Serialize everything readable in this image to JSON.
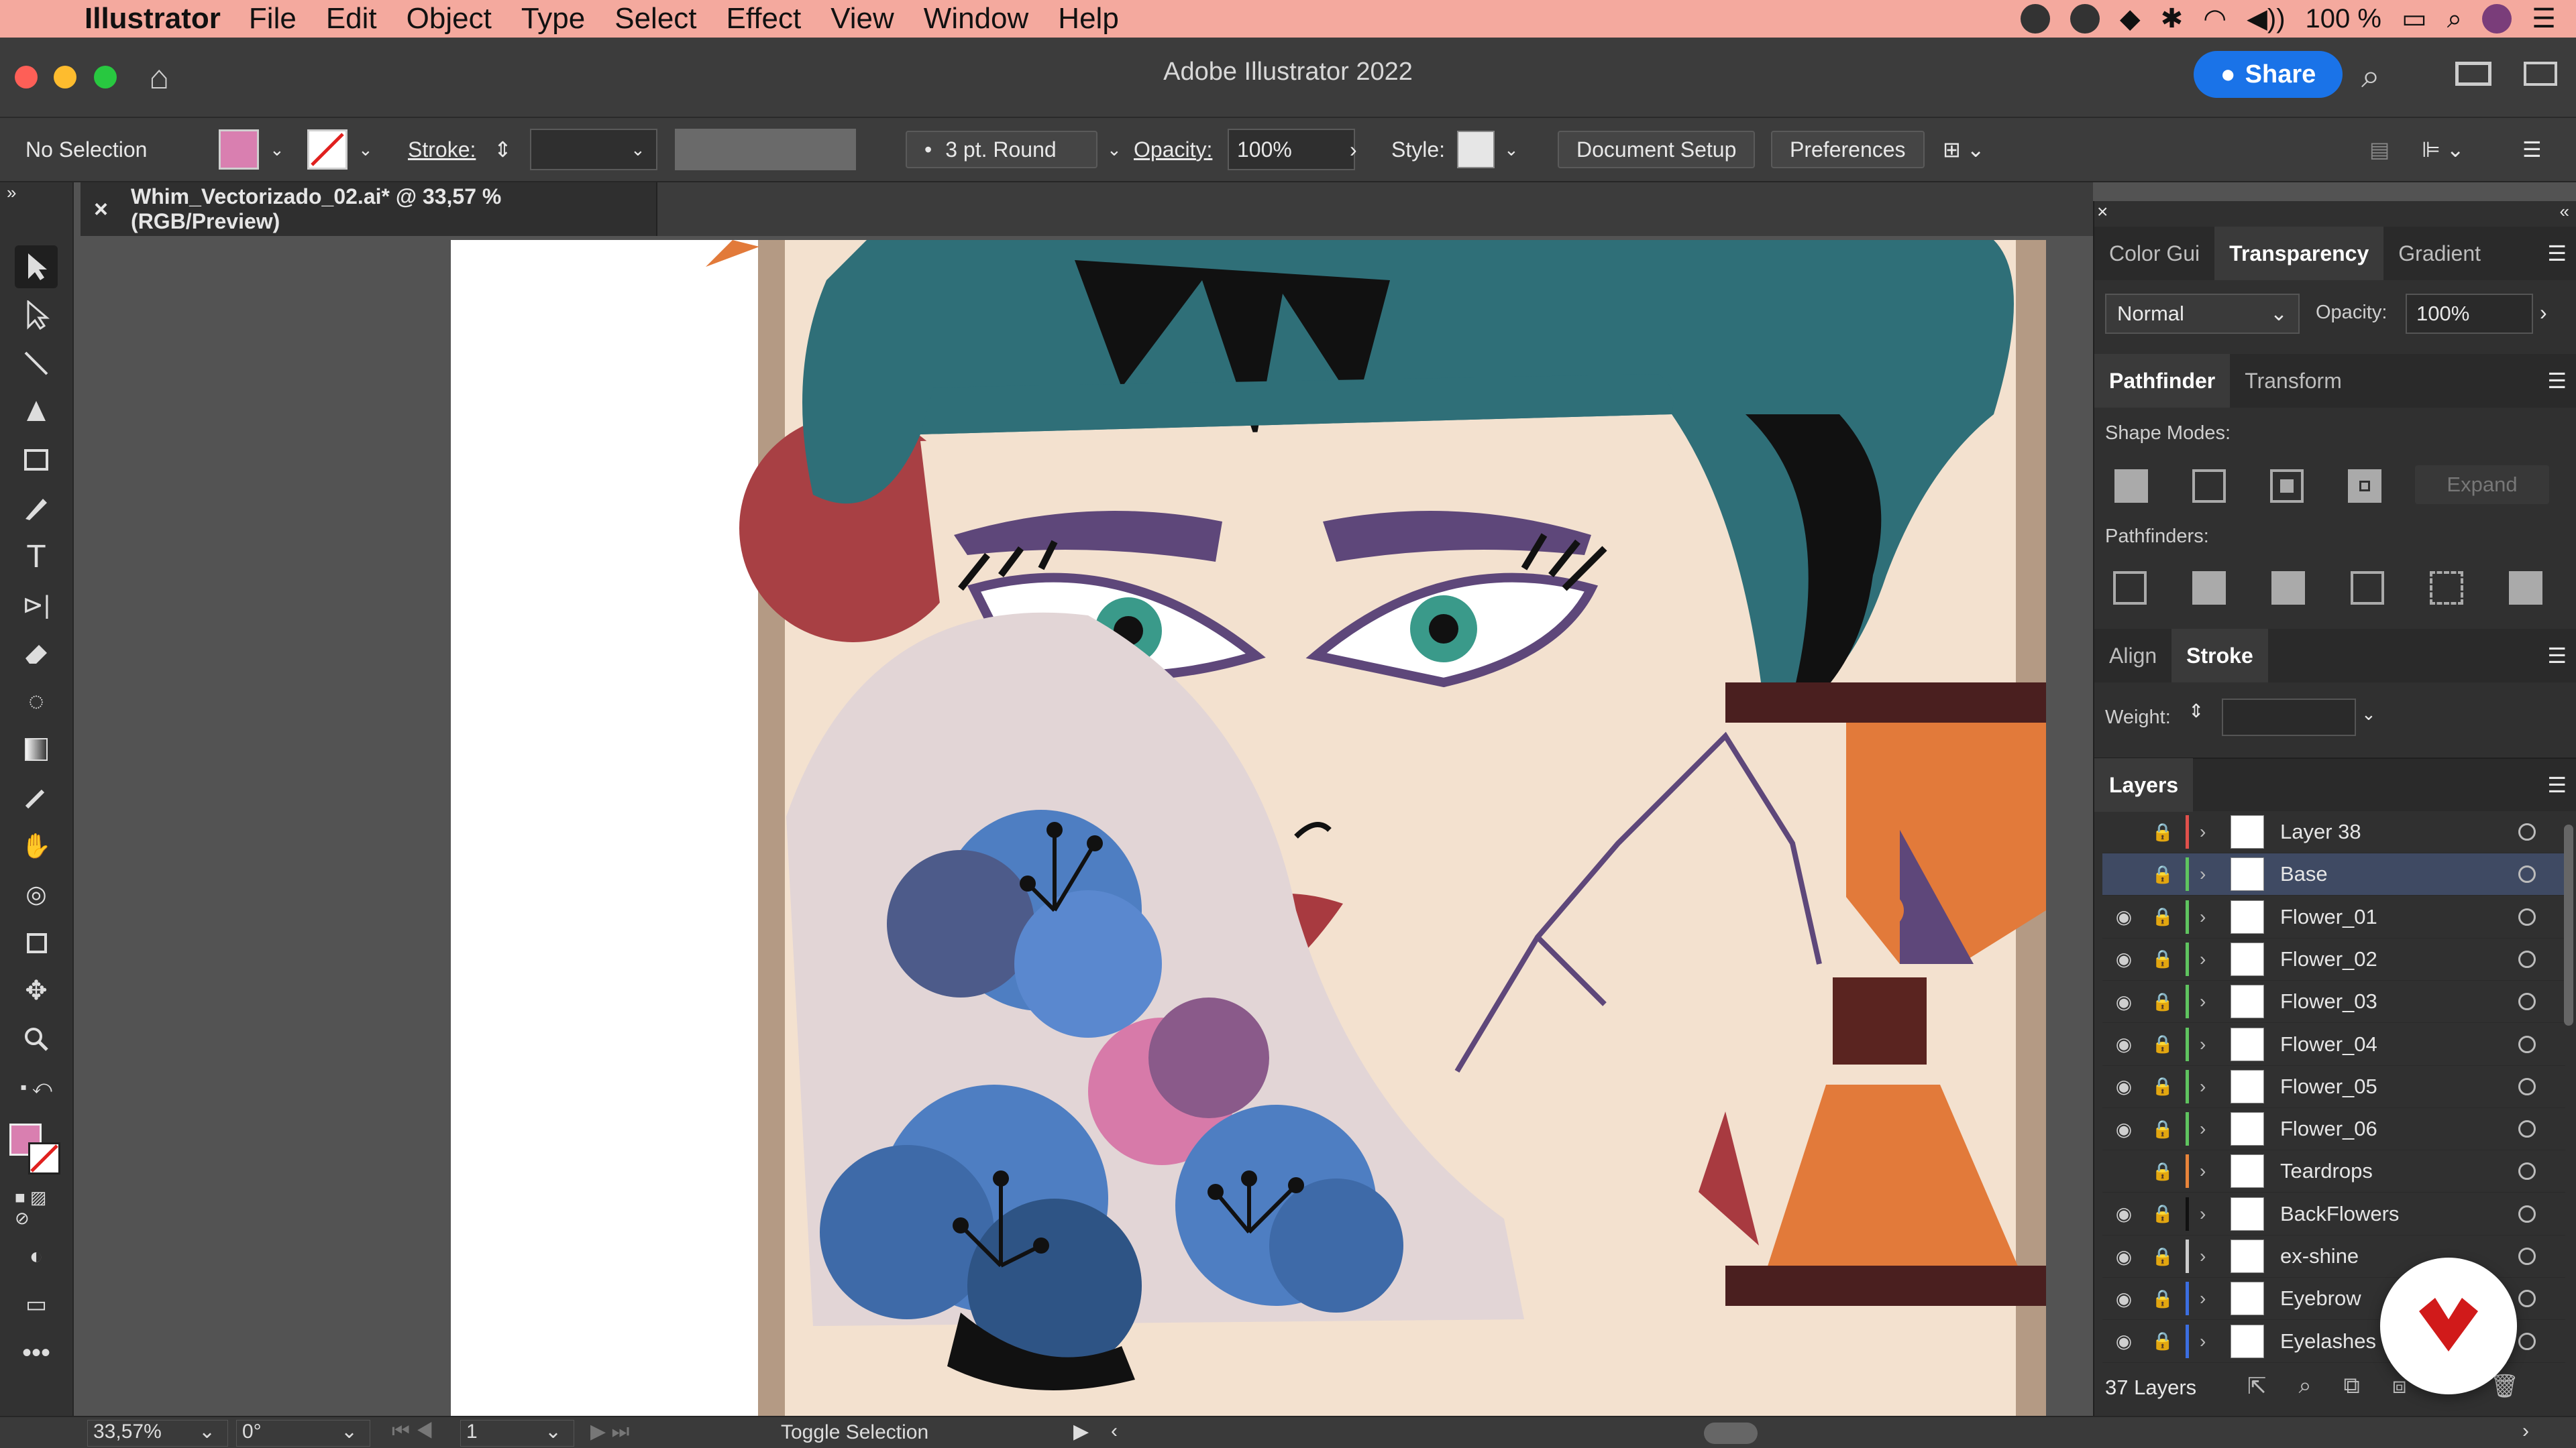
{
  "menubar": {
    "app": "Illustrator",
    "items": [
      "File",
      "Edit",
      "Object",
      "Type",
      "Select",
      "Effect",
      "View",
      "Window",
      "Help"
    ],
    "battery": "100 %"
  },
  "window": {
    "title": "Adobe Illustrator 2022",
    "share": "Share"
  },
  "control": {
    "selection": "No Selection",
    "stroke_label": "Stroke:",
    "brush": "3 pt. Round",
    "opacity_label": "Opacity:",
    "opacity": "100%",
    "style_label": "Style:",
    "document_setup": "Document Setup",
    "preferences": "Preferences",
    "fill_color": "#d97fb0"
  },
  "doc_tab": {
    "name": "Whim_Vectorizado_02.ai* @ 33,57 % (RGB/Preview)"
  },
  "panels": {
    "tabs1": [
      "Color Gui",
      "Transparency",
      "Gradient"
    ],
    "blend_mode": "Normal",
    "opacity_label": "Opacity:",
    "opacity": "100%",
    "tabs2": [
      "Pathfinder",
      "Transform"
    ],
    "shape_modes": "Shape Modes:",
    "expand": "Expand",
    "pathfinders": "Pathfinders:",
    "tabs3": [
      "Align",
      "Stroke"
    ],
    "weight_label": "Weight:",
    "layers_title": "Layers",
    "layers_count": "37 Layers",
    "layers": [
      {
        "name": "Layer 38",
        "color": "#e0504b",
        "visible": false,
        "selected": false
      },
      {
        "name": "Base",
        "color": "#5fc45f",
        "visible": false,
        "selected": true
      },
      {
        "name": "Flower_01",
        "color": "#5fc45f",
        "visible": true,
        "selected": false
      },
      {
        "name": "Flower_02",
        "color": "#5fc45f",
        "visible": true,
        "selected": false
      },
      {
        "name": "Flower_03",
        "color": "#5fc45f",
        "visible": true,
        "selected": false
      },
      {
        "name": "Flower_04",
        "color": "#5fc45f",
        "visible": true,
        "selected": false
      },
      {
        "name": "Flower_05",
        "color": "#5fc45f",
        "visible": true,
        "selected": false
      },
      {
        "name": "Flower_06",
        "color": "#5fc45f",
        "visible": true,
        "selected": false
      },
      {
        "name": "Teardrops",
        "color": "#e8843a",
        "visible": false,
        "selected": false
      },
      {
        "name": "BackFlowers",
        "color": "#111111",
        "visible": true,
        "selected": false
      },
      {
        "name": "ex-shine",
        "color": "#cccccc",
        "visible": true,
        "selected": false
      },
      {
        "name": "Eyebrow",
        "color": "#3b6ee0",
        "visible": true,
        "selected": false
      },
      {
        "name": "Eyelashes",
        "color": "#3b6ee0",
        "visible": true,
        "selected": false
      }
    ]
  },
  "status": {
    "zoom": "33,57%",
    "rotation": "0°",
    "artboard": "1",
    "toggle": "Toggle Selection"
  }
}
